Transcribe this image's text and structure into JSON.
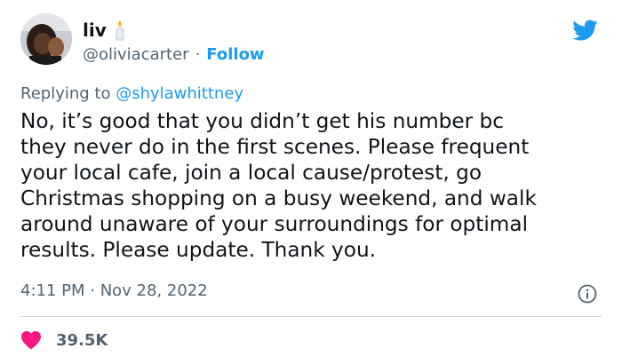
{
  "author": {
    "display_name": "liv",
    "handle": "@oliviacarter",
    "separator": "·",
    "follow_label": "Follow"
  },
  "reply": {
    "prefix": "Replying to ",
    "mention": "@shylawhittney"
  },
  "tweet": {
    "lines": [
      "No, it’s good that you didn’t get his number bc",
      "they never do in the first scenes. Please frequent",
      "your local cafe, join a local cause/protest, go",
      "Christmas shopping on a busy weekend, and walk",
      "around unaware of your surroundings for optimal",
      "results. Please update. Thank you."
    ],
    "timestamp": "4:11 PM · Nov 28, 2022"
  },
  "engagement": {
    "likes": "39.5K"
  },
  "icons": {
    "brand": "twitter-bird-icon",
    "emoji": "candle-icon",
    "info": "info-icon",
    "like": "heart-icon"
  },
  "colors": {
    "brand_blue": "#1d9bf0",
    "like_red": "#f91880",
    "text": "#0f1419",
    "secondary": "#536471"
  }
}
